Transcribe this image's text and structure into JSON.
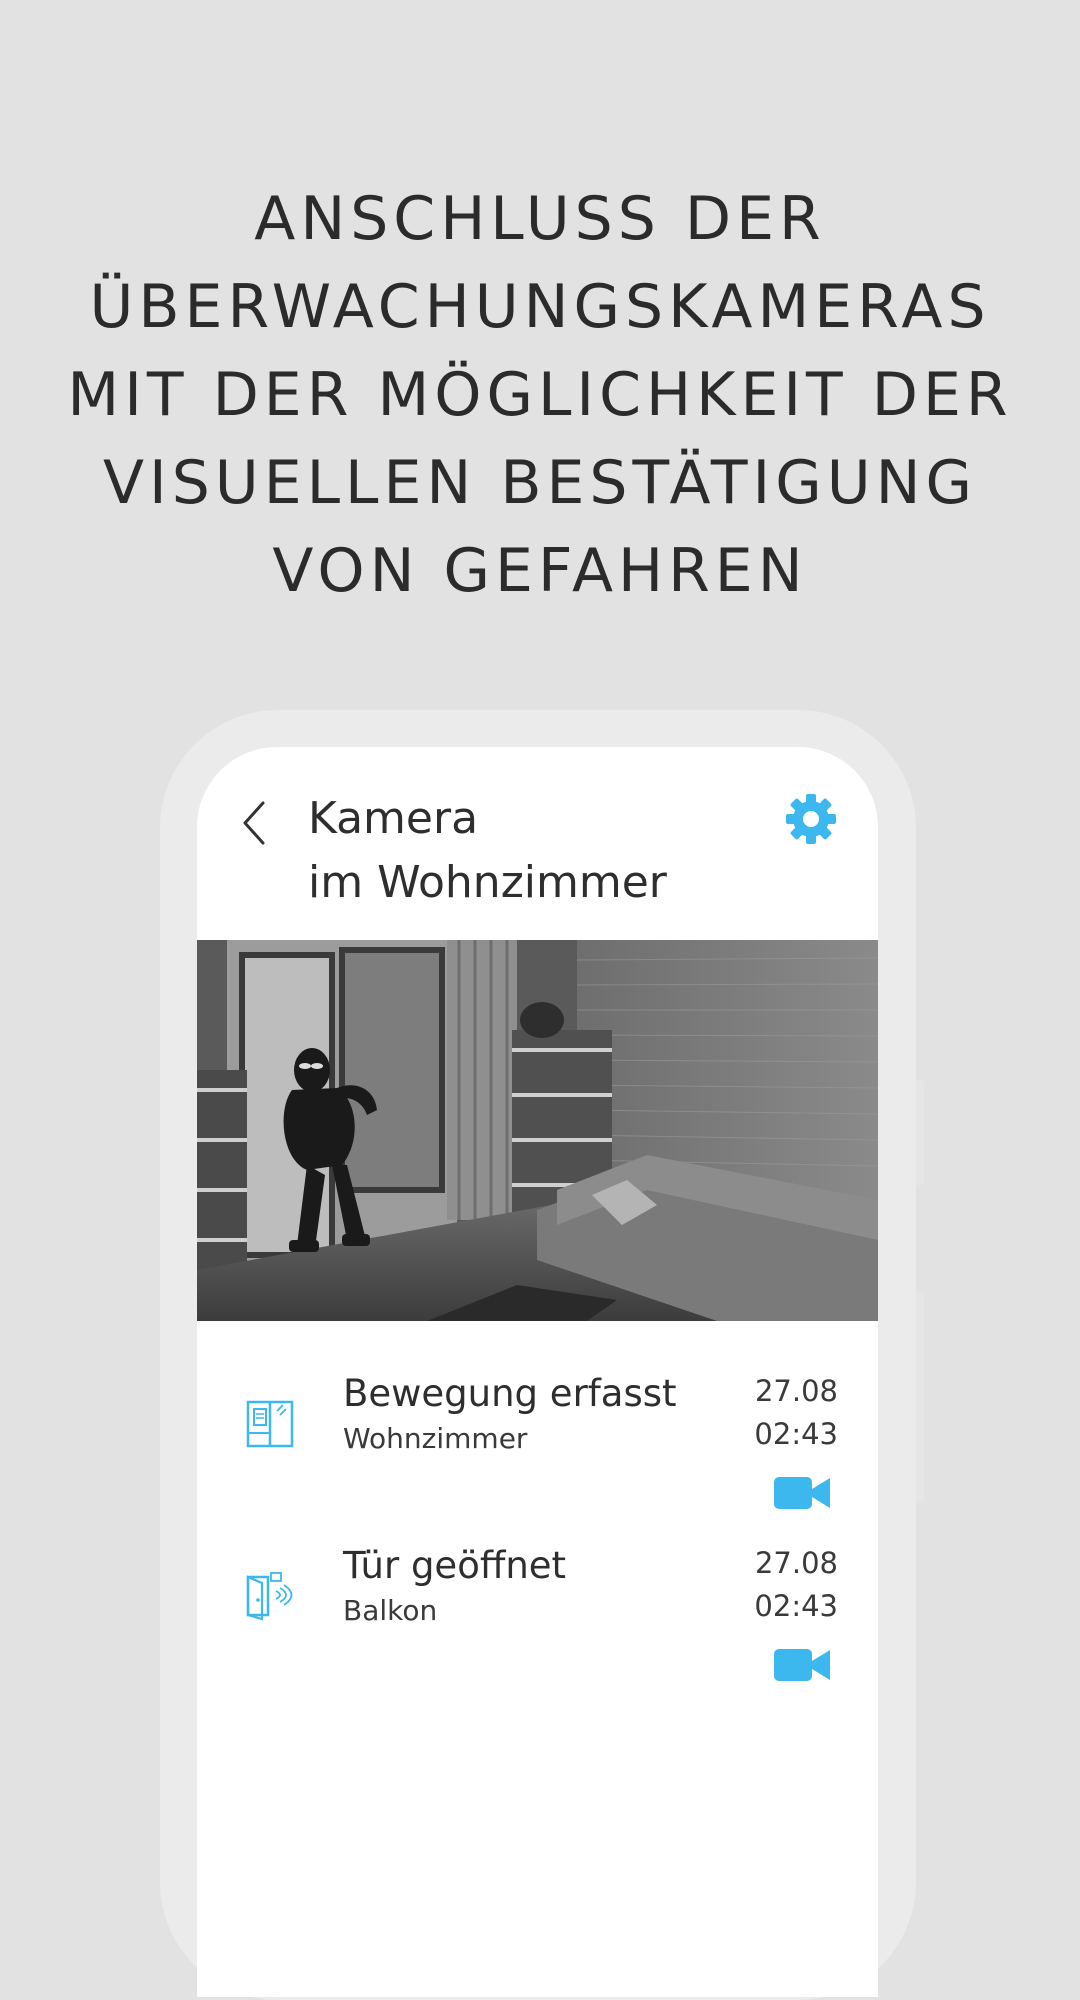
{
  "headline": {
    "lines": [
      "ANSCHLUSS DER",
      "ÜBERWACHUNGSKAMERAS",
      "MIT DER MÖGLICHKEIT DER",
      "VISUELLEN BESTÄTIGUNG",
      "VON GEFAHREN"
    ]
  },
  "header": {
    "title_line1": "Kamera",
    "title_line2": "im Wohnzimmer",
    "back_icon": "chevron-left-icon",
    "settings_icon": "gear-icon"
  },
  "camera": {
    "image": "grayscale camera still of a masked intruder entering a living room through a balcony door"
  },
  "events": [
    {
      "title": "Bewegung erfasst",
      "location": "Wohnzimmer",
      "date": "27.08",
      "time": "02:43",
      "icon": "motion-sensor-icon",
      "action_icon": "video-camera-icon"
    },
    {
      "title": "Tür geöffnet",
      "location": "Balkon",
      "date": "27.08",
      "time": "02:43",
      "icon": "door-sensor-icon",
      "action_icon": "video-camera-icon"
    }
  ],
  "colors": {
    "accent": "#3cb8ee",
    "background": "#e2e2e2",
    "text": "#2e2e2e"
  }
}
